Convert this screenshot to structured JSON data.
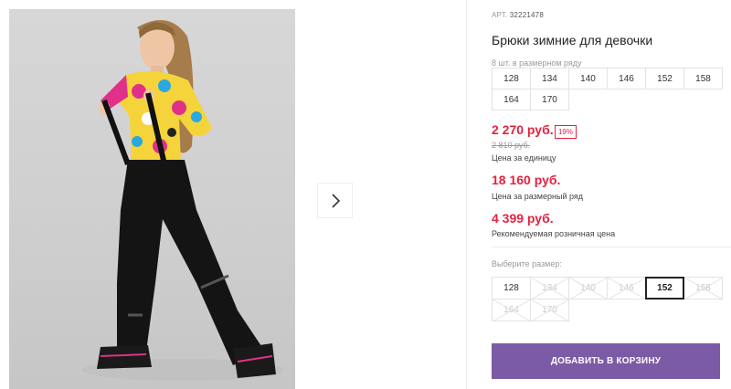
{
  "product": {
    "art_label": "АРТ.",
    "art_number": "32221478",
    "title": "Брюки зимние для девочки"
  },
  "series": {
    "label": "8 шт. в размерном ряду",
    "sizes": [
      "128",
      "134",
      "140",
      "146",
      "152",
      "158",
      "164",
      "170"
    ]
  },
  "prices": {
    "unit_price": "2 270 руб.",
    "discount_badge": "19%",
    "old_price": "2 810 руб.",
    "unit_caption": "Цена за единицу",
    "series_price": "18 160 руб.",
    "series_caption": "Цена за размерный ряд",
    "retail_price": "4 399 руб.",
    "retail_caption": "Рекомендуемая розничная цена"
  },
  "size_choice": {
    "label": "Выберите размер:",
    "sizes": [
      {
        "label": "128",
        "state": "available"
      },
      {
        "label": "134",
        "state": "disabled"
      },
      {
        "label": "140",
        "state": "disabled"
      },
      {
        "label": "146",
        "state": "disabled"
      },
      {
        "label": "152",
        "state": "selected"
      },
      {
        "label": "158",
        "state": "disabled"
      },
      {
        "label": "164",
        "state": "disabled"
      },
      {
        "label": "170",
        "state": "disabled"
      }
    ]
  },
  "cart_button": "ДОБАВИТЬ В КОРЗИНУ",
  "icons": {
    "next": "chevron-right-icon"
  },
  "colors": {
    "accent": "#7b5aa6",
    "price": "#e4233f"
  }
}
